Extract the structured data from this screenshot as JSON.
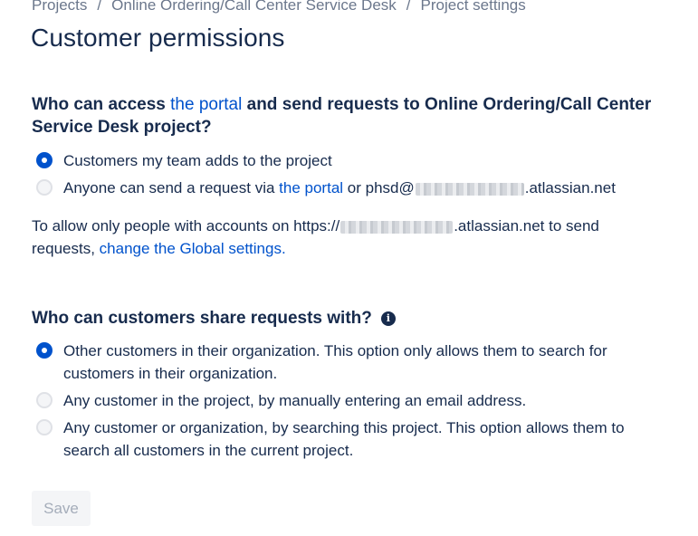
{
  "breadcrumb": {
    "items": [
      "Projects",
      "Online Ordering/Call Center Service Desk",
      "Project settings"
    ],
    "separator": "/"
  },
  "page": {
    "title": "Customer permissions"
  },
  "access_section": {
    "heading_prefix": "Who can access ",
    "heading_link": "the portal",
    "heading_suffix": " and send requests to Online Ordering/Call Center Service Desk project?",
    "options": [
      {
        "label": "Customers my team adds to the project",
        "selected": true
      },
      {
        "label_prefix": "Anyone can send a request via ",
        "label_link": "the portal",
        "label_mid": " or phsd@",
        "label_suffix": ".atlassian.net",
        "selected": false
      }
    ],
    "note_prefix": "To allow only people with accounts on https://",
    "note_mid": ".atlassian.net to send requests, ",
    "note_link": "change the Global settings."
  },
  "share_section": {
    "heading": "Who can customers share requests with?",
    "info_icon": "i",
    "options": [
      {
        "label": "Other customers in their organization. This option only allows them to search for customers in their organization.",
        "selected": true
      },
      {
        "label": "Any customer in the project, by manually entering an email address.",
        "selected": false
      },
      {
        "label": "Any customer or organization, by searching this project. This option allows them to search all customers in the current project.",
        "selected": false
      }
    ]
  },
  "actions": {
    "save_label": "Save"
  },
  "colors": {
    "link": "#0052cc",
    "text": "#172b4d",
    "radio_selected": "#0052cc"
  }
}
